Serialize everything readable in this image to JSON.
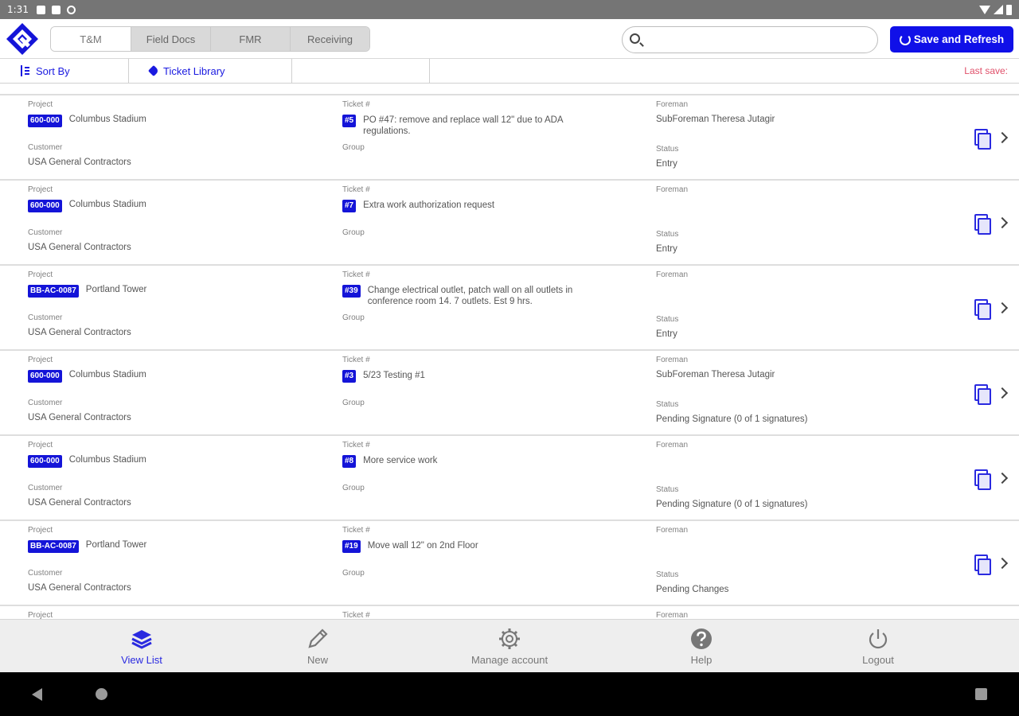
{
  "statusbar": {
    "time": "1:31"
  },
  "header": {
    "tabs": [
      {
        "label": "T&M",
        "active": true
      },
      {
        "label": "Field Docs",
        "active": false
      },
      {
        "label": "FMR",
        "active": false
      },
      {
        "label": "Receiving",
        "active": false
      }
    ],
    "search": {
      "placeholder": "",
      "value": ""
    },
    "save_label": "Save and Refresh"
  },
  "subbar": {
    "sort_label": "Sort By",
    "library_label": "Ticket Library",
    "last_save_label": "Last save:"
  },
  "labels": {
    "project": "Project",
    "ticket": "Ticket #",
    "foreman": "Foreman",
    "customer": "Customer",
    "group": "Group",
    "status": "Status"
  },
  "tickets": [
    {
      "project_code": "600-000",
      "project_name": "Columbus Stadium",
      "ticket_no": "#5",
      "description": "PO #47: remove and replace wall 12\" due to ADA regulations.",
      "foreman": "SubForeman Theresa Jutagir",
      "customer": "USA General Contractors",
      "group": "",
      "status": "Entry"
    },
    {
      "project_code": "600-000",
      "project_name": "Columbus Stadium",
      "ticket_no": "#7",
      "description": "Extra work authorization request",
      "foreman": "",
      "customer": "USA General Contractors",
      "group": "",
      "status": "Entry"
    },
    {
      "project_code": "BB-AC-0087",
      "project_name": "Portland Tower",
      "ticket_no": "#39",
      "description": "Change electrical outlet, patch wall on all outlets in conference room 14. 7 outlets. Est 9 hrs.",
      "foreman": "",
      "customer": "USA General Contractors",
      "group": "",
      "status": "Entry"
    },
    {
      "project_code": "600-000",
      "project_name": "Columbus Stadium",
      "ticket_no": "#3",
      "description": "5/23 Testing #1",
      "foreman": "SubForeman Theresa Jutagir",
      "customer": "USA General Contractors",
      "group": "",
      "status": "Pending Signature (0 of 1 signatures)"
    },
    {
      "project_code": "600-000",
      "project_name": "Columbus Stadium",
      "ticket_no": "#8",
      "description": "More service work",
      "foreman": "",
      "customer": "USA General Contractors",
      "group": "",
      "status": "Pending Signature (0 of 1 signatures)"
    },
    {
      "project_code": "BB-AC-0087",
      "project_name": "Portland Tower",
      "ticket_no": "#19",
      "description": "Move wall 12\" on 2nd Floor",
      "foreman": "",
      "customer": "USA General Contractors",
      "group": "",
      "status": "Pending Changes"
    }
  ],
  "bottom_nav": [
    {
      "label": "View List",
      "icon": "stack-icon",
      "active": true
    },
    {
      "label": "New",
      "icon": "pencil-icon",
      "active": false
    },
    {
      "label": "Manage account",
      "icon": "gear-icon",
      "active": false
    },
    {
      "label": "Help",
      "icon": "help-icon",
      "active": false
    },
    {
      "label": "Logout",
      "icon": "power-icon",
      "active": false
    }
  ],
  "colors": {
    "accent": "#1414d8",
    "last_save": "#e0506a"
  }
}
